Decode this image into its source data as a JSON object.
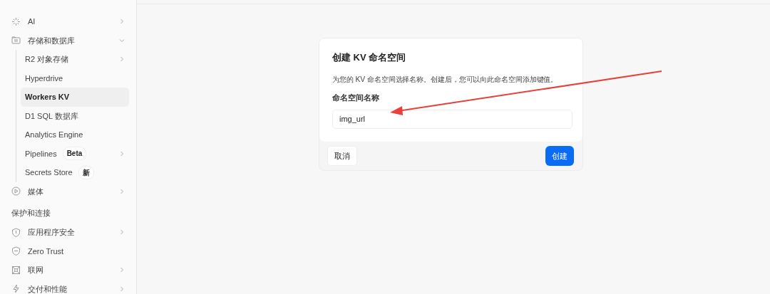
{
  "sidebar": {
    "items": [
      {
        "kind": "item",
        "label": "AI",
        "expandable": true
      },
      {
        "kind": "item",
        "label": "存储和数据库",
        "expandable": true,
        "expanded": true,
        "children": [
          {
            "label": "R2 对象存储",
            "expandable": true,
            "selected": false
          },
          {
            "label": "Hyperdrive",
            "selected": false
          },
          {
            "label": "Workers KV",
            "selected": true
          },
          {
            "label": "D1 SQL 数据库",
            "selected": false
          },
          {
            "label": "Analytics Engine",
            "selected": false
          },
          {
            "label": "Pipelines",
            "badge": "Beta",
            "expandable": true,
            "selected": false
          },
          {
            "label": "Secrets Store",
            "badge": "新",
            "selected": false
          }
        ]
      },
      {
        "kind": "item",
        "label": "媒体",
        "expandable": true
      },
      {
        "kind": "section",
        "label": "保护和连接"
      },
      {
        "kind": "item",
        "label": "应用程序安全",
        "expandable": true
      },
      {
        "kind": "item",
        "label": "Zero Trust"
      },
      {
        "kind": "item",
        "label": "联网",
        "expandable": true
      },
      {
        "kind": "item",
        "label": "交付和性能",
        "expandable": true
      }
    ]
  },
  "dialog": {
    "title": "创建 KV 命名空间",
    "description": "为您的 KV 命名空间选择名称。创建后，您可以向此命名空间添加键值。",
    "field_label": "命名空间名称",
    "field_value": "img_url",
    "buttons": [
      {
        "label": "取消",
        "kind": "secondary"
      },
      {
        "label": "创建",
        "kind": "primary"
      }
    ]
  }
}
